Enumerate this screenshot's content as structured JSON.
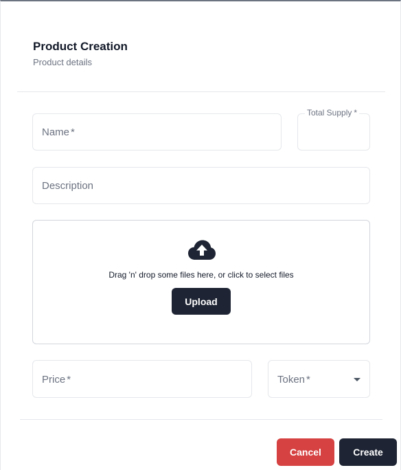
{
  "header": {
    "title": "Product Creation",
    "subtitle": "Product details"
  },
  "form": {
    "name": {
      "placeholder": "Name",
      "required_mark": "*"
    },
    "total_supply": {
      "label": "Total Supply",
      "required_mark": "*",
      "value": ""
    },
    "description": {
      "placeholder": "Description"
    },
    "dropzone": {
      "icon": "cloud-upload-icon",
      "instructions": "Drag 'n' drop some files here, or click to select files",
      "upload_label": "Upload"
    },
    "price": {
      "placeholder": "Price",
      "required_mark": "*"
    },
    "token": {
      "placeholder": "Token",
      "required_mark": "*",
      "icon": "caret-down-icon"
    }
  },
  "footer": {
    "cancel_label": "Cancel",
    "create_label": "Create"
  },
  "colors": {
    "primary_button": "#1e2433",
    "cancel_button": "#d64141",
    "border": "#e5e7eb",
    "muted_text": "#6b7280"
  }
}
